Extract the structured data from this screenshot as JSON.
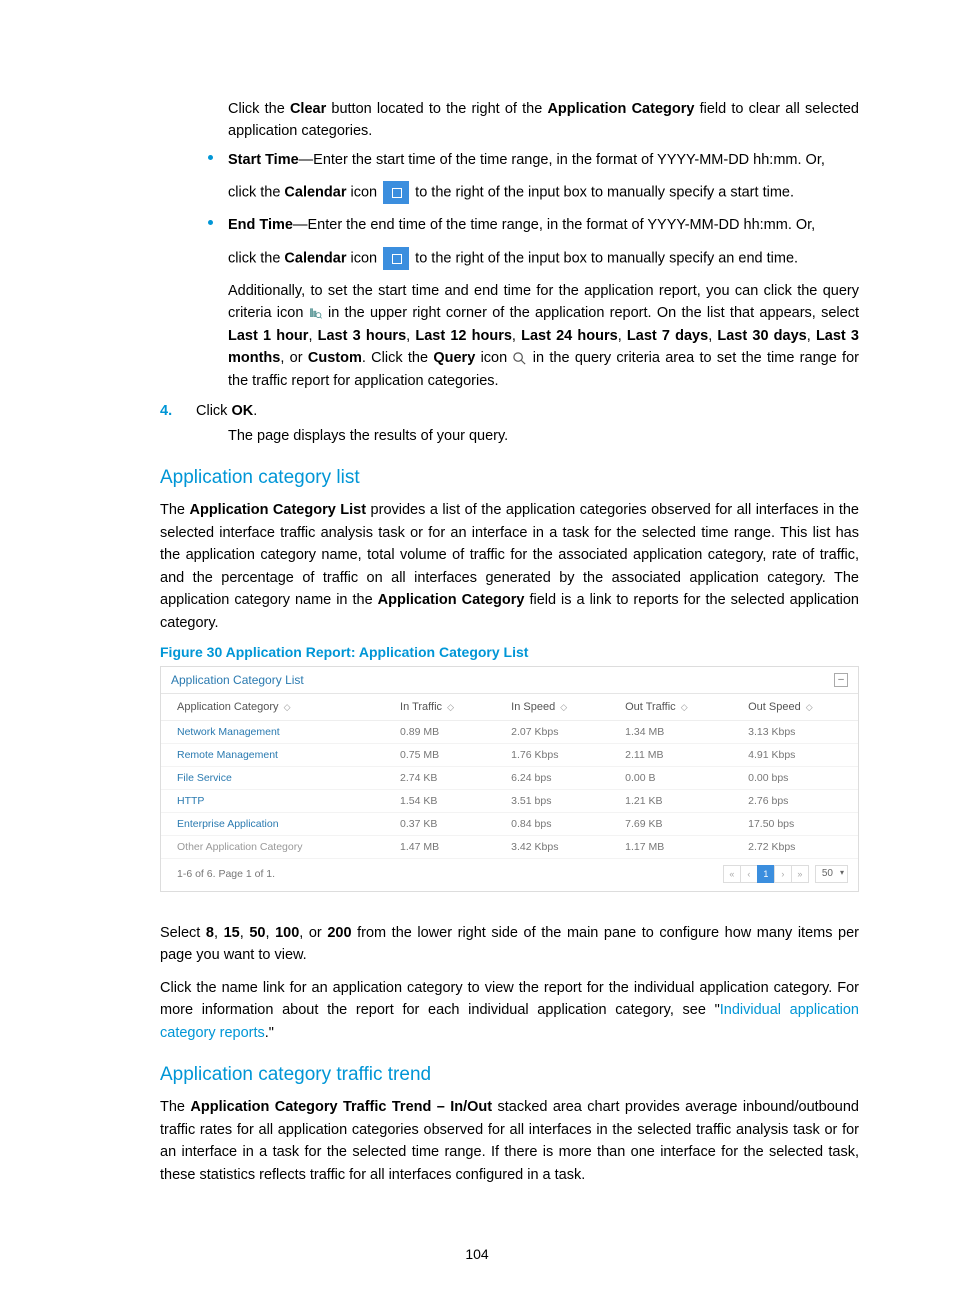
{
  "intro_para": {
    "pre": "Click the ",
    "b1": "Clear",
    "mid": " button located to the right of the ",
    "b2": "Application Category",
    "post": " field to clear all selected application categories."
  },
  "bullet_start": {
    "label": "Start Time",
    "line1_rest": "—Enter the start time of the time range, in the format of YYYY-MM-DD hh:mm. Or,",
    "line2_pre": "click the ",
    "line2_b": "Calendar",
    "line2_mid": " icon ",
    "line2_post": " to the right of the input box to manually specify a start time."
  },
  "bullet_end": {
    "label": "End Time",
    "line1_rest": "—Enter the end time of the time range, in the format of YYYY-MM-DD hh:mm. Or,",
    "line2_pre": "click the ",
    "line2_b": "Calendar",
    "line2_mid": " icon ",
    "line2_post": " to the right of the input box to manually specify an end time.",
    "extra_p1_pre": "Additionally, to set the start time and end time for the application report, you can click the query criteria icon ",
    "extra_p1_post": " in the upper right corner of the application report. On the list that appears, select ",
    "opts": [
      "Last 1 hour",
      "Last 3 hours",
      "Last 12 hours",
      "Last 24 hours",
      "Last 7 days",
      "Last 30 days",
      "Last 3 months",
      "Custom"
    ],
    "extra_p2_pre": ". Click the ",
    "extra_p2_b": "Query",
    "extra_p2_mid": " icon ",
    "extra_p2_post": " in the query criteria area to set the time range for the traffic report for application categories."
  },
  "step4": {
    "num": "4.",
    "pre": "Click ",
    "b": "OK",
    "post": ".",
    "after": "The page displays the results of your query."
  },
  "h1": "Application category list",
  "para1": {
    "pre": "The ",
    "b1": "Application Category List",
    "mid1": " provides a list of the application categories observed for all interfaces in the selected interface traffic analysis task or for an interface in a task for the selected time range. This list has the application category name, total volume of traffic for the associated application category, rate of traffic, and the percentage of traffic on all interfaces generated by the associated application category. The application category name in the ",
    "b2": "Application Category",
    "post": " field is a link to reports for the selected application category."
  },
  "figcap": "Figure 30 Application Report: Application Category List",
  "panel": {
    "title": "Application Category List",
    "cols": [
      "Application Category",
      "In Traffic",
      "In Speed",
      "Out Traffic",
      "Out Speed"
    ],
    "rows": [
      {
        "name": "Network Management",
        "link": true,
        "v": [
          "0.89 MB",
          "2.07 Kbps",
          "1.34 MB",
          "3.13 Kbps"
        ]
      },
      {
        "name": "Remote Management",
        "link": true,
        "v": [
          "0.75 MB",
          "1.76 Kbps",
          "2.11 MB",
          "4.91 Kbps"
        ]
      },
      {
        "name": "File Service",
        "link": true,
        "v": [
          "2.74 KB",
          "6.24 bps",
          "0.00 B",
          "0.00 bps"
        ]
      },
      {
        "name": "HTTP",
        "link": true,
        "v": [
          "1.54 KB",
          "3.51 bps",
          "1.21 KB",
          "2.76 bps"
        ]
      },
      {
        "name": "Enterprise Application",
        "link": true,
        "v": [
          "0.37 KB",
          "0.84 bps",
          "7.69 KB",
          "17.50 bps"
        ]
      },
      {
        "name": "Other Application Category",
        "link": false,
        "v": [
          "1.47 MB",
          "3.42 Kbps",
          "1.17 MB",
          "2.72 Kbps"
        ]
      }
    ],
    "footer": "1-6 of 6. Page 1 of 1.",
    "page_current": "1",
    "page_size": "50"
  },
  "para2": {
    "pre": "Select ",
    "o": [
      "8",
      "15",
      "50",
      "100",
      "200"
    ],
    "mid": " from the lower right side of the main pane to configure how many items per page you want to view."
  },
  "para3": {
    "line1": "Click the name link for an application category to view the report for the individual application category. For more information about the report for each individual application category, see \"",
    "link": "Individual application category reports",
    "post": ".\""
  },
  "h2": "Application category traffic trend",
  "para4": {
    "pre": "The ",
    "b": "Application Category Traffic Trend – In/Out",
    "post": " stacked area chart provides average inbound/outbound traffic rates for all application categories observed for all interfaces in the selected traffic analysis task or for an interface in a task for the selected time range. If there is more than one interface for the selected task, these statistics reflects traffic for all interfaces configured in a task."
  },
  "page_number": "104"
}
